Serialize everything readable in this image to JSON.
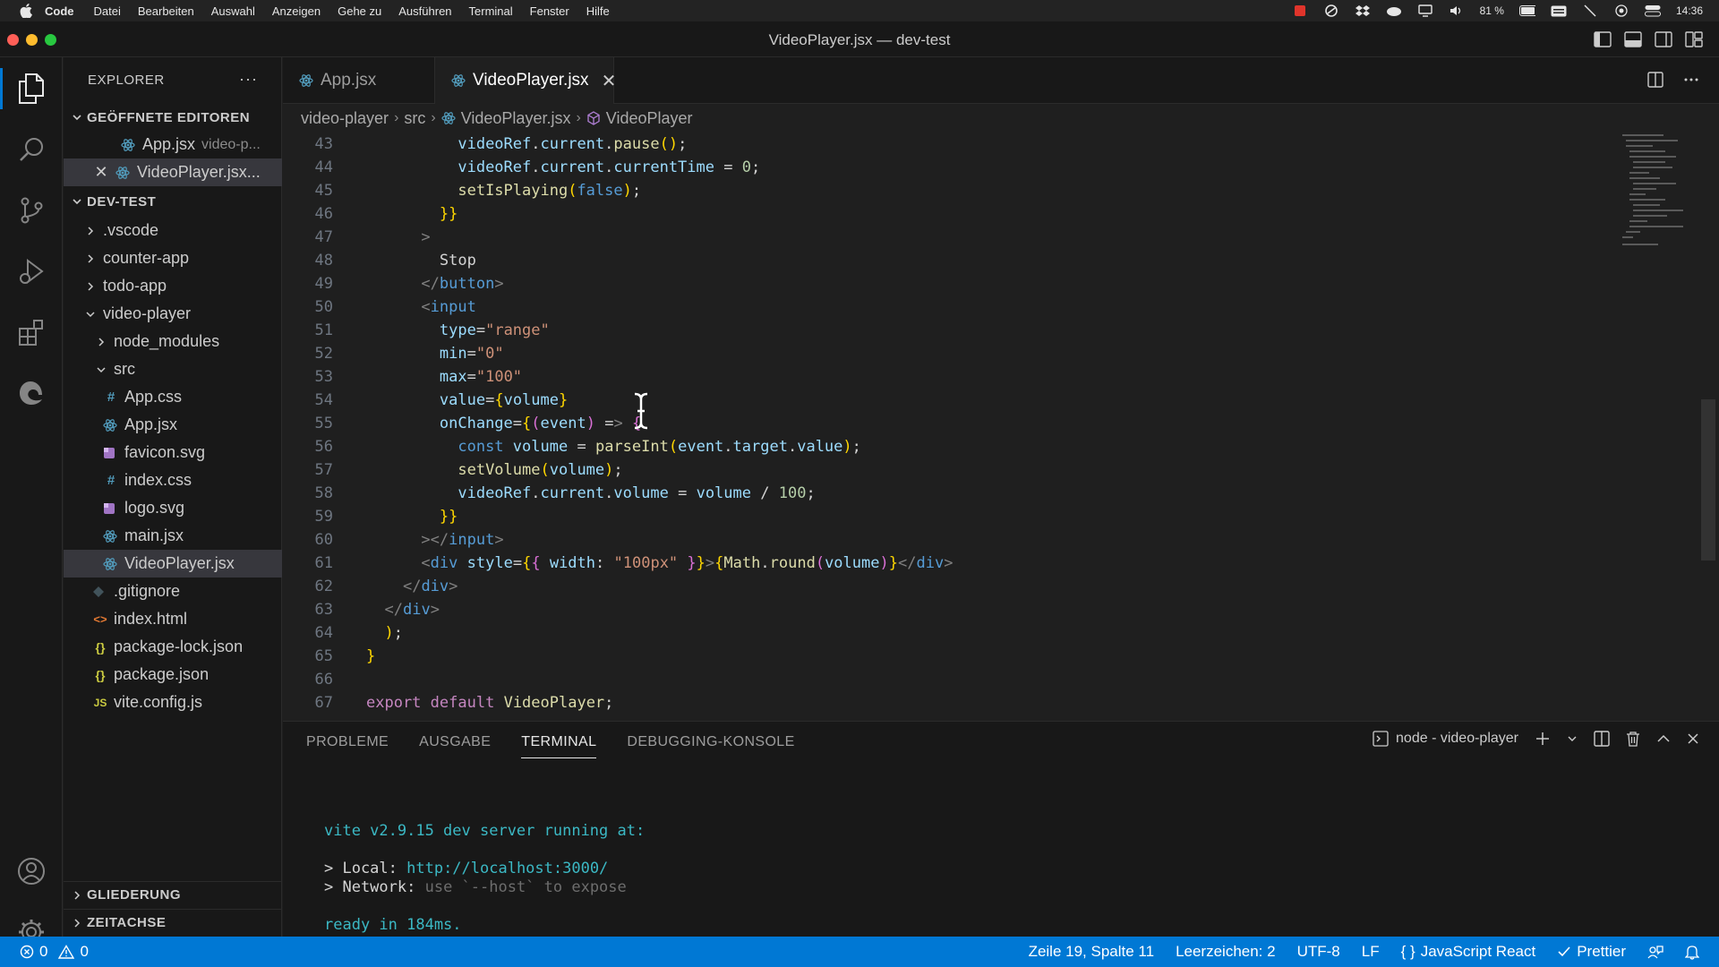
{
  "menubar": {
    "app": "Code",
    "items": [
      "Datei",
      "Bearbeiten",
      "Auswahl",
      "Anzeigen",
      "Gehe zu",
      "Ausführen",
      "Terminal",
      "Fenster",
      "Hilfe"
    ],
    "battery": "81 %",
    "clock": "14:36"
  },
  "window": {
    "title": "VideoPlayer.jsx — dev-test"
  },
  "sidebar": {
    "title": "EXPLORER",
    "more": "···",
    "open_editors": {
      "title": "GEÖFFNETE EDITOREN",
      "items": [
        {
          "name": "App.jsx",
          "path": "video-p..."
        },
        {
          "name": "VideoPlayer.jsx..."
        }
      ]
    },
    "project": {
      "title": "DEV-TEST",
      "items": [
        {
          "name": ".vscode",
          "icon": ""
        },
        {
          "name": "counter-app",
          "icon": ""
        },
        {
          "name": "todo-app",
          "icon": ""
        },
        {
          "name": "video-player",
          "icon": ""
        },
        {
          "name": "node_modules",
          "icon": ""
        },
        {
          "name": "src",
          "icon": ""
        },
        {
          "name": "App.css",
          "icon": "#"
        },
        {
          "name": "App.jsx",
          "icon": ""
        },
        {
          "name": "favicon.svg",
          "icon": ""
        },
        {
          "name": "index.css",
          "icon": "#"
        },
        {
          "name": "logo.svg",
          "icon": ""
        },
        {
          "name": "main.jsx",
          "icon": ""
        },
        {
          "name": "VideoPlayer.jsx",
          "icon": ""
        },
        {
          "name": ".gitignore",
          "icon": ""
        },
        {
          "name": "index.html",
          "icon": "<>"
        },
        {
          "name": "package-lock.json",
          "icon": "{}"
        },
        {
          "name": "package.json",
          "icon": "{}"
        },
        {
          "name": "vite.config.js",
          "icon": "JS"
        }
      ]
    },
    "outline": "GLIEDERUNG",
    "timeline": "ZEITACHSE"
  },
  "tabs": [
    {
      "label": "App.jsx",
      "active": false
    },
    {
      "label": "VideoPlayer.jsx",
      "active": true,
      "close": "✕"
    }
  ],
  "breadcrumb": [
    "video-player",
    "src",
    "VideoPlayer.jsx",
    "VideoPlayer"
  ],
  "code": {
    "lines": [
      {
        "n": "43",
        "t": "          videoRef.current.pause();"
      },
      {
        "n": "44",
        "t": "          videoRef.current.currentTime = 0;"
      },
      {
        "n": "45",
        "t": "          setIsPlaying(false);"
      },
      {
        "n": "46",
        "t": "        }}"
      },
      {
        "n": "47",
        "t": "      >"
      },
      {
        "n": "48",
        "t": "        Stop"
      },
      {
        "n": "49",
        "t": "      </button>"
      },
      {
        "n": "50",
        "t": "      <input"
      },
      {
        "n": "51",
        "t": "        type=\"range\""
      },
      {
        "n": "52",
        "t": "        min=\"0\""
      },
      {
        "n": "53",
        "t": "        max=\"100\""
      },
      {
        "n": "54",
        "t": "        value={volume}"
      },
      {
        "n": "55",
        "t": "        onChange={(event) => {"
      },
      {
        "n": "56",
        "t": "          const volume = parseInt(event.target.value);"
      },
      {
        "n": "57",
        "t": "          setVolume(volume);"
      },
      {
        "n": "58",
        "t": "          videoRef.current.volume = volume / 100;"
      },
      {
        "n": "59",
        "t": "        }}"
      },
      {
        "n": "60",
        "t": "      ></input>"
      },
      {
        "n": "61",
        "t": "      <div style={{ width: \"100px\" }}>{Math.round(volume)}</div>"
      },
      {
        "n": "62",
        "t": "    </div>"
      },
      {
        "n": "63",
        "t": "  </div>"
      },
      {
        "n": "64",
        "t": "  );"
      },
      {
        "n": "65",
        "t": "}"
      },
      {
        "n": "66",
        "t": ""
      },
      {
        "n": "67",
        "t": "export default VideoPlayer;"
      }
    ]
  },
  "panel": {
    "tabs": [
      "PROBLEME",
      "AUSGABE",
      "TERMINAL",
      "DEBUGGING-KONSOLE"
    ],
    "active_tab": "TERMINAL",
    "terminal_name": "node - video-player",
    "output": {
      "line1": "vite v2.9.15 dev server running at:",
      "local_prefix": "> Local: ",
      "local_url": "http://localhost:3000/",
      "network_prefix": "> Network: ",
      "network_rest": "use `--host` to expose",
      "ready": "ready in 184ms."
    }
  },
  "statusbar": {
    "errors": "0",
    "warnings": "0",
    "position": "Zeile 19, Spalte 11",
    "spaces": "Leerzeichen: 2",
    "encoding": "UTF-8",
    "eol": "LF",
    "language": "JavaScript React",
    "prettier": "Prettier"
  },
  "colors": {
    "accent": "#0078d4",
    "editor_bg": "#1f1f1f",
    "sidebar_bg": "#181818",
    "react_icon": "#519aba",
    "svg_icon": "#a074c4",
    "css_icon": "#519aba",
    "json_icon": "#cbcb41",
    "html_icon": "#e37933"
  }
}
